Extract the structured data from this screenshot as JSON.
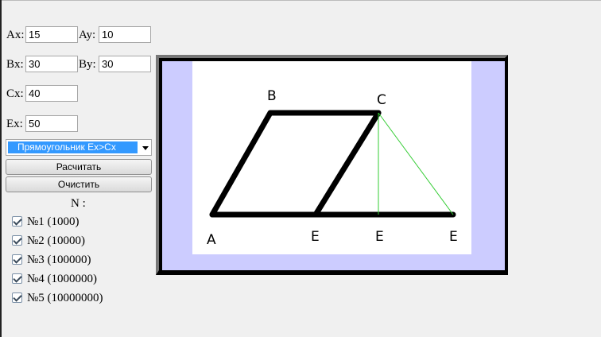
{
  "inputs": {
    "ax": {
      "label": "Ax:",
      "value": "15"
    },
    "ay": {
      "label": "Ay:",
      "value": "10"
    },
    "bx": {
      "label": "Bx:",
      "value": "30"
    },
    "by": {
      "label": "By:",
      "value": "30"
    },
    "cx": {
      "label": "Cx:",
      "value": "40"
    },
    "ex": {
      "label": "Ex:",
      "value": "50"
    }
  },
  "shape_select": {
    "selected": "Прямоугольник Ex>Cx"
  },
  "buttons": {
    "calculate": "Расчитать",
    "clear": "Очистить"
  },
  "n_label": "N :",
  "checkboxes": [
    {
      "label": "№1 (1000)",
      "checked": true
    },
    {
      "label": "№2 (10000)",
      "checked": true
    },
    {
      "label": "№3 (100000)",
      "checked": true
    },
    {
      "label": "№4 (1000000)",
      "checked": true
    },
    {
      "label": "№5 (10000000)",
      "checked": true
    }
  ],
  "diagram": {
    "labels": {
      "a": "A",
      "b": "B",
      "c": "C",
      "e1": "E",
      "e2": "E",
      "e3": "E"
    },
    "colors": {
      "outline": "#000000",
      "guide": "#33cc33",
      "background": "#ccccff"
    }
  }
}
